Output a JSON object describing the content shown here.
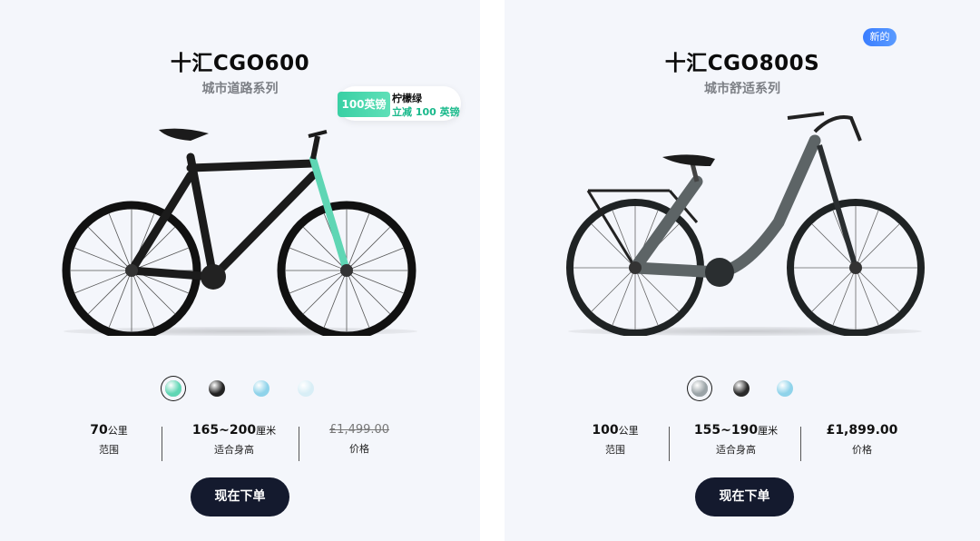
{
  "products": [
    {
      "name": "十汇CGO600",
      "series": "城市道路系列",
      "coupon": {
        "ticket": "100英镑",
        "name": "柠檬绿",
        "desc": "立减 100 英镑"
      },
      "stats": [
        {
          "value": "70",
          "unit": "公里",
          "label": "范围"
        },
        {
          "value": "165~200",
          "unit": "厘米",
          "label": "适合身高"
        },
        {
          "value": "£1,499.00",
          "unit": "",
          "label": "价格"
        }
      ],
      "order_button": "现在下单",
      "colors": [
        "#5fd6b4",
        "#222222",
        "#8fd3ea",
        "#d8eef6"
      ]
    },
    {
      "name": "十汇CGO800S",
      "series": "城市舒适系列",
      "badge": "新的",
      "stats": [
        {
          "value": "100",
          "unit": "公里",
          "label": "范围"
        },
        {
          "value": "155~190",
          "unit": "厘米",
          "label": "适合身高"
        },
        {
          "value": "£1,899.00",
          "unit": "",
          "label": "价格"
        }
      ],
      "order_button": "现在下单",
      "colors": [
        "#9aa3a7",
        "#2a2a2a",
        "#8fd3ea"
      ]
    }
  ]
}
